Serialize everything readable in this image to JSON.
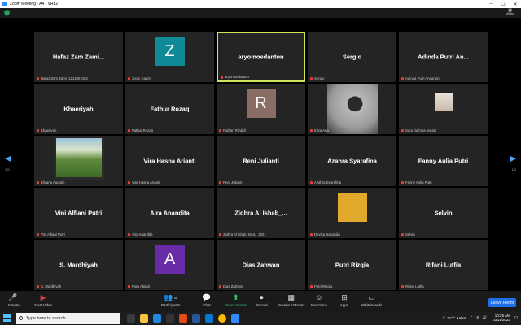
{
  "window": {
    "title": "Zoom Meeting - A4 - VR82"
  },
  "topbar": {
    "view_label": "View"
  },
  "pager": {
    "left_num": "1/2",
    "right_num": "1/2"
  },
  "tiles": [
    {
      "name": "Hafaz Zam Zami...",
      "tag": "Hafaz Zam Zami_1211001052"
    },
    {
      "name": "",
      "tag": "zoom Eaa04",
      "avatar": "Z",
      "avatar_color": "#0f8a96"
    },
    {
      "name": "aryomoedanton",
      "tag": "aryomoedanton",
      "active": true
    },
    {
      "name": "Sergio",
      "tag": "Sergio"
    },
    {
      "name": "Adinda Putri An...",
      "tag": "Adinda Putri Anggraini"
    },
    {
      "name": "Khaeriyah",
      "tag": "Khaeriyah"
    },
    {
      "name": "Fathur Rozaq",
      "tag": "Fathur Rozaq"
    },
    {
      "name": "",
      "tag": "Raihan Rizaldi",
      "avatar": "R",
      "avatar_color": "#8a6e66"
    },
    {
      "name": "",
      "tag": "Eliza Ana",
      "photo": "portrait"
    },
    {
      "name": "",
      "tag": "Sara fadhma lestari",
      "photo": "small"
    },
    {
      "name": "",
      "tag": "Eliyana Agustin",
      "photo": "landscape"
    },
    {
      "name": "Vira Hasna Arianti",
      "tag": "Vira Hasna Arianti"
    },
    {
      "name": "Reni Julianti",
      "tag": "Reni Julianti"
    },
    {
      "name": "Azahra Syarafina",
      "tag": "Azahra Syarafina"
    },
    {
      "name": "Fanny Aulia Putri",
      "tag": "Fanny Aulia Putri"
    },
    {
      "name": "Vini Alfiani Putri",
      "tag": "Vini Alfiani Putri"
    },
    {
      "name": "Aira Anandita",
      "tag": "Aira Anandita"
    },
    {
      "name": "Ziqhra Al Ishab_...",
      "tag": "Ziqhra Al Ishab_MNU_2021"
    },
    {
      "name": "",
      "tag": "Devika Salsabila",
      "avatar": "",
      "avatar_color": "#e0a92c"
    },
    {
      "name": "Selvin",
      "tag": "Selvin"
    },
    {
      "name": "S. Mardhiyah",
      "tag": "S. Mardhiyah"
    },
    {
      "name": "",
      "tag": "Ratu Alpiah",
      "avatar": "A",
      "avatar_color": "#6a2ca6"
    },
    {
      "name": "Dias Zahwan",
      "tag": "Dias Zahwan"
    },
    {
      "name": "Putri Rizqia",
      "tag": "Putri Rizqia"
    },
    {
      "name": "Rifani Lutfia",
      "tag": "Rifani Lutfia"
    }
  ],
  "controls": {
    "unmute": "Unmute",
    "start_video": "Start Video",
    "participants": "Participants",
    "participants_count": "38",
    "chat": "Chat",
    "share_screen": "Share Screen",
    "record": "Record",
    "breakout": "Breakout Rooms",
    "reactions": "Reactions",
    "apps": "Apps",
    "whiteboards": "Whiteboards",
    "leave": "Leave Room"
  },
  "taskbar": {
    "search_placeholder": "Type here to search",
    "weather": "31°C Kabut",
    "time": "10:25 AM",
    "date": "10/11/2022"
  }
}
